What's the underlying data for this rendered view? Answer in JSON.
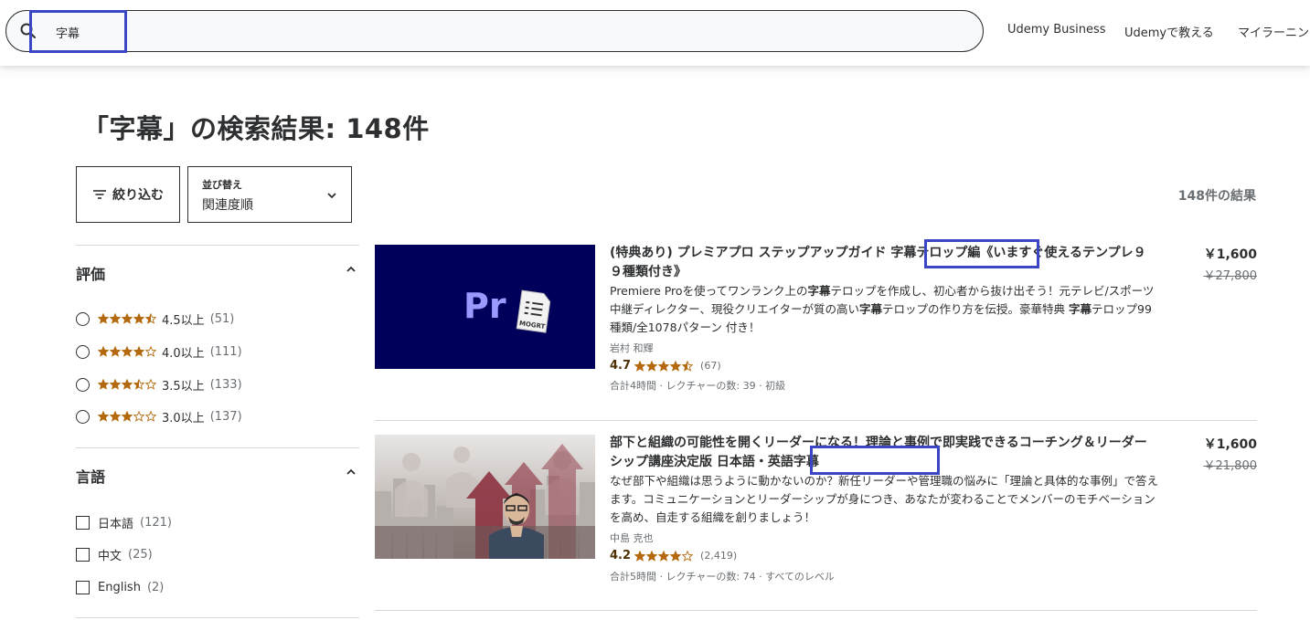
{
  "header": {
    "search_value": "字幕",
    "nav": [
      "Udemy Business",
      "Udemyで教える",
      "マイラーニング"
    ]
  },
  "page_title": "「字幕」の検索結果: 148件",
  "toolbar": {
    "filter_label": "絞り込む",
    "sort_label": "並び替え",
    "sort_value": "関連度順",
    "result_count": "148件の結果"
  },
  "filters": {
    "rating_title": "評価",
    "ratings": [
      {
        "label": "4.5以上",
        "count": "(51)",
        "stars": 4.5
      },
      {
        "label": "4.0以上",
        "count": "(111)",
        "stars": 4.0
      },
      {
        "label": "3.5以上",
        "count": "(133)",
        "stars": 3.5
      },
      {
        "label": "3.0以上",
        "count": "(137)",
        "stars": 3.0
      }
    ],
    "language_title": "言語",
    "languages": [
      {
        "label": "日本語",
        "count": "(121)"
      },
      {
        "label": "中文",
        "count": "(25)"
      },
      {
        "label": "English",
        "count": "(2)"
      }
    ]
  },
  "courses": [
    {
      "title_a": "(特典あり) プレミアプロ ステップアップガイド ",
      "title_hl": "字幕テロップ編",
      "title_b": "《いますぐ使えるテンプレ９９種類付き》",
      "desc_a": "Premiere Proを使ってワンランク上の",
      "desc_b1": "字幕",
      "desc_c": "テロップを作成し、初心者から抜け出そう！元テレビ/スポーツ中継ディレクター、現役クリエイターが質の高い",
      "desc_b2": "字幕",
      "desc_d": "テロップの作り方を伝授。豪華特典 ",
      "desc_b3": "字幕",
      "desc_e": "テロップ99種類/全1078パターン 付き！",
      "thumb_pr": "Pr",
      "thumb_file": "MOGRT",
      "instructor": "岩村 和輝",
      "rating": "4.7",
      "stars": 4.5,
      "reviews": "(67)",
      "meta": "合計4時間 · レクチャーの数: 39 · 初級",
      "price": "￥1,600",
      "old_price": "￥27,800"
    },
    {
      "title_a": "部下と組織の可能性を開くリーダーになる！理論と事例で即実践できるコーチング＆リーダーシップ講座決定版 ",
      "title_hl": "日本語・英語字幕",
      "title_b": "",
      "desc": "なぜ部下や組織は思うように動かないのか？新任リーダーや管理職の悩みに「理論と具体的な事例」で答えます。コミュニケーションとリーダーシップが身につき、あなたが変わることでメンバーのモチベーションを高め、自走する組織を創りましょう！",
      "instructor": "中島 克也",
      "rating": "4.2",
      "stars": 4.0,
      "reviews": "(2,419)",
      "meta": "合計5時間 · レクチャーの数: 74 · すべてのレベル",
      "price": "￥1,600",
      "old_price": "￥21,800"
    }
  ],
  "colors": {
    "star": "#b4690e",
    "highlight_box": "#3b46c4",
    "thumb1_bg": "#00005b",
    "pr_text": "#9999ff"
  }
}
